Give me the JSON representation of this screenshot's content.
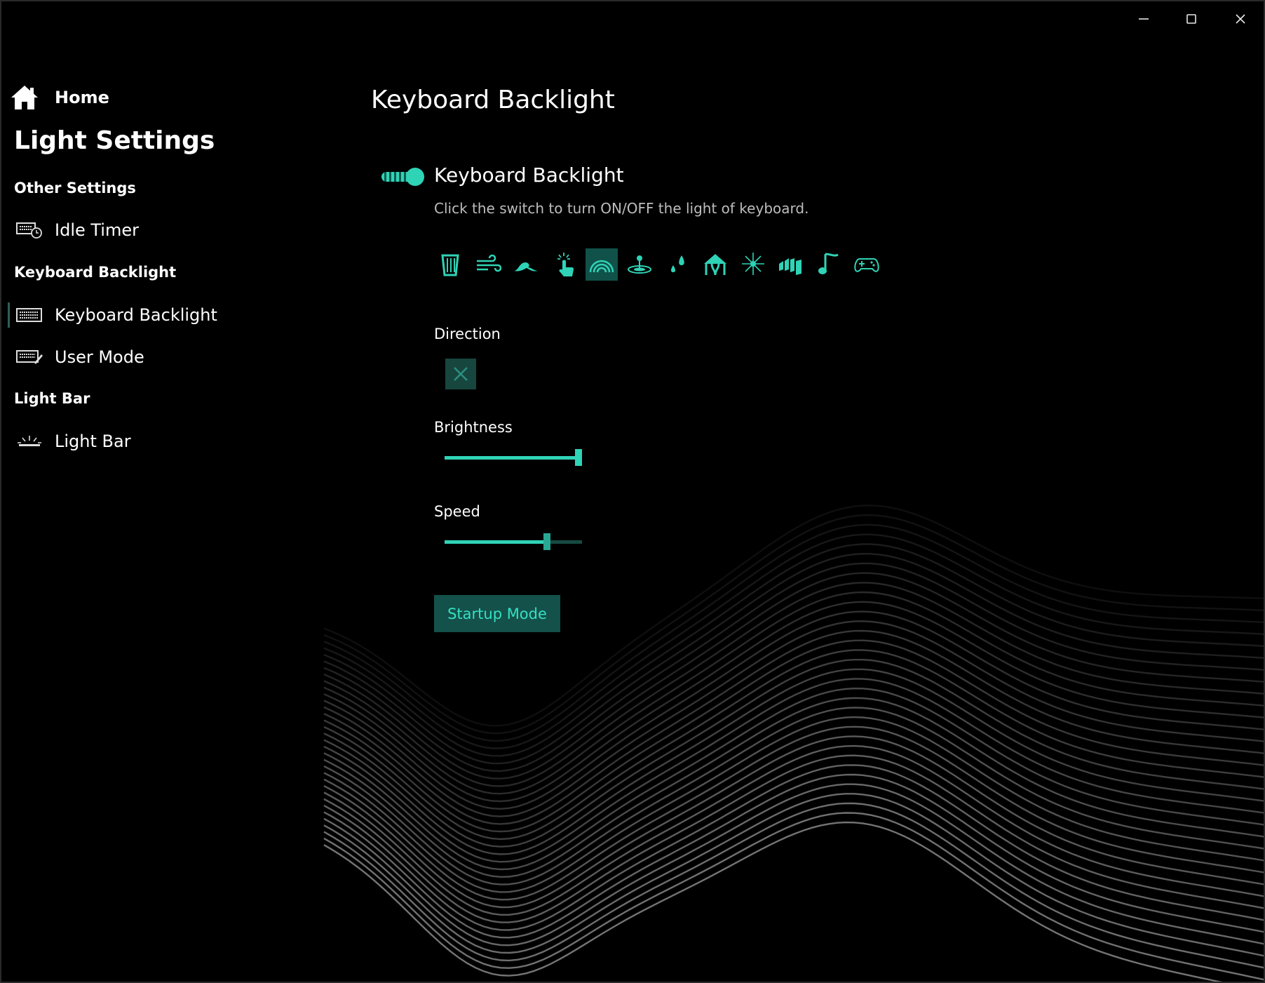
{
  "window": {
    "controls": [
      "minimize-icon",
      "maximize-icon",
      "close-icon"
    ]
  },
  "sidebar": {
    "home_label": "Home",
    "title": "Light Settings",
    "sections": [
      {
        "label": "Other Settings",
        "items": [
          {
            "label": "Idle Timer",
            "icon": "keyboard-timer-icon"
          }
        ]
      },
      {
        "label": "Keyboard Backlight",
        "items": [
          {
            "label": "Keyboard Backlight",
            "icon": "keyboard-icon",
            "selected": true
          },
          {
            "label": "User Mode",
            "icon": "keyboard-edit-icon"
          }
        ]
      },
      {
        "label": "Light Bar",
        "items": [
          {
            "label": "Light Bar",
            "icon": "light-bar-icon"
          }
        ]
      }
    ]
  },
  "main": {
    "title": "Keyboard Backlight",
    "toggle": {
      "label": "Keyboard Backlight",
      "on": true,
      "description": "Click the switch to turn ON/OFF the light of keyboard."
    },
    "effects": [
      {
        "name": "static-icon"
      },
      {
        "name": "wind-icon"
      },
      {
        "name": "wave-icon"
      },
      {
        "name": "touch-icon"
      },
      {
        "name": "rainbow-icon",
        "selected": true
      },
      {
        "name": "ripple-icon"
      },
      {
        "name": "raindrop-icon"
      },
      {
        "name": "circus-icon"
      },
      {
        "name": "sparkle-icon"
      },
      {
        "name": "aurora-icon"
      },
      {
        "name": "music-icon"
      },
      {
        "name": "gamepad-icon"
      }
    ],
    "direction": {
      "label": "Direction",
      "value_icon": "x-icon"
    },
    "brightness": {
      "label": "Brightness",
      "value": 1.0
    },
    "speed": {
      "label": "Speed",
      "value": 0.76
    },
    "startup_button": "Startup Mode"
  },
  "colors": {
    "accent": "#2fd3b6",
    "accent_dark": "#105149",
    "background": "#000000",
    "muted_text": "#bdbdbd"
  }
}
